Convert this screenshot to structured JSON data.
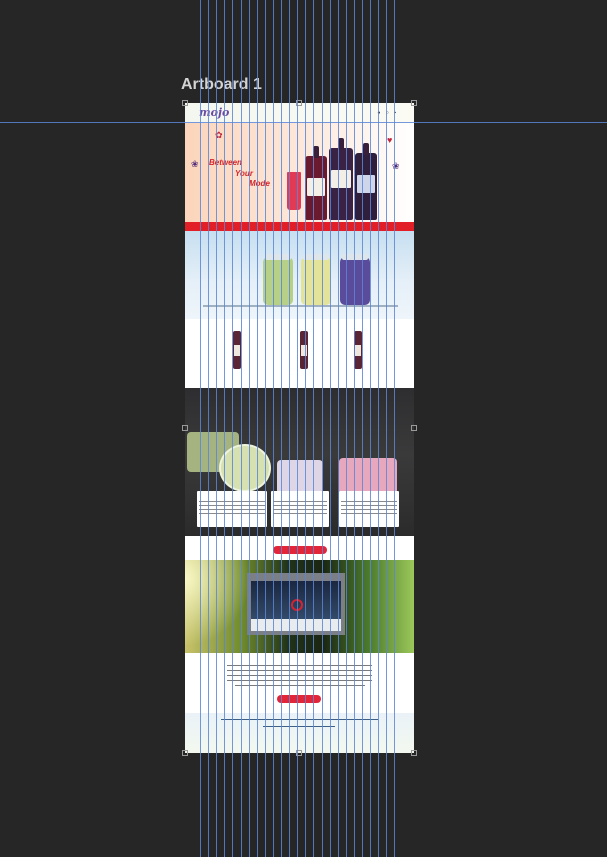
{
  "artboard": {
    "title": "Artboard 1"
  },
  "header": {
    "logo": "mojo",
    "icons": [
      "user-icon",
      "search-icon",
      "cart-icon"
    ]
  },
  "hero": {
    "text_lines": [
      "Between",
      "Your",
      "Mode"
    ]
  },
  "jars": {
    "captions": [
      "",
      ""
    ]
  },
  "products": {
    "title": "",
    "items": [
      {
        "caption": ""
      },
      {
        "caption": ""
      },
      {
        "caption": ""
      }
    ]
  },
  "drinks": {
    "cards": [
      {
        "title": ""
      },
      {
        "title": ""
      },
      {
        "title": ""
      }
    ]
  },
  "buttons": {
    "section_button": "",
    "about_button": ""
  },
  "forest": {
    "title": ""
  },
  "footer": {
    "line1": "",
    "line2": ""
  },
  "colors": {
    "accent_red": "#e21f26",
    "canvas": "#262626",
    "guide": "#5b86d6"
  }
}
